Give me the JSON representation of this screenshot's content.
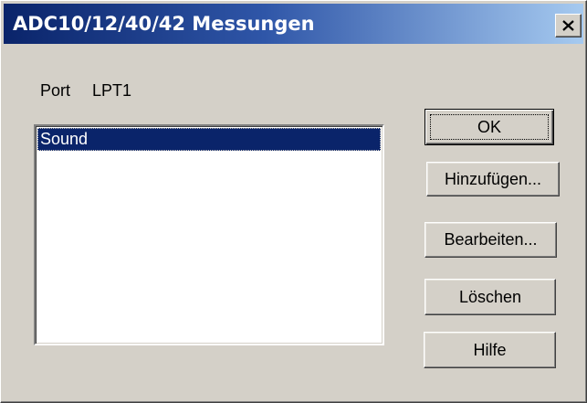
{
  "window": {
    "title": "ADC10/12/40/42 Messungen"
  },
  "port": {
    "label": "Port",
    "value": "LPT1"
  },
  "list": {
    "items": [
      {
        "label": "Sound",
        "selected": true
      }
    ]
  },
  "buttons": {
    "ok": "OK",
    "add": "Hinzufügen...",
    "edit": "Bearbeiten...",
    "delete": "Löschen",
    "help": "Hilfe"
  },
  "colors": {
    "titlebar_start": "#0a246a",
    "titlebar_end": "#a6caf0",
    "dialog_face": "#d4d0c8",
    "selection": "#0a246a"
  },
  "icons": {
    "close": "close-icon"
  }
}
